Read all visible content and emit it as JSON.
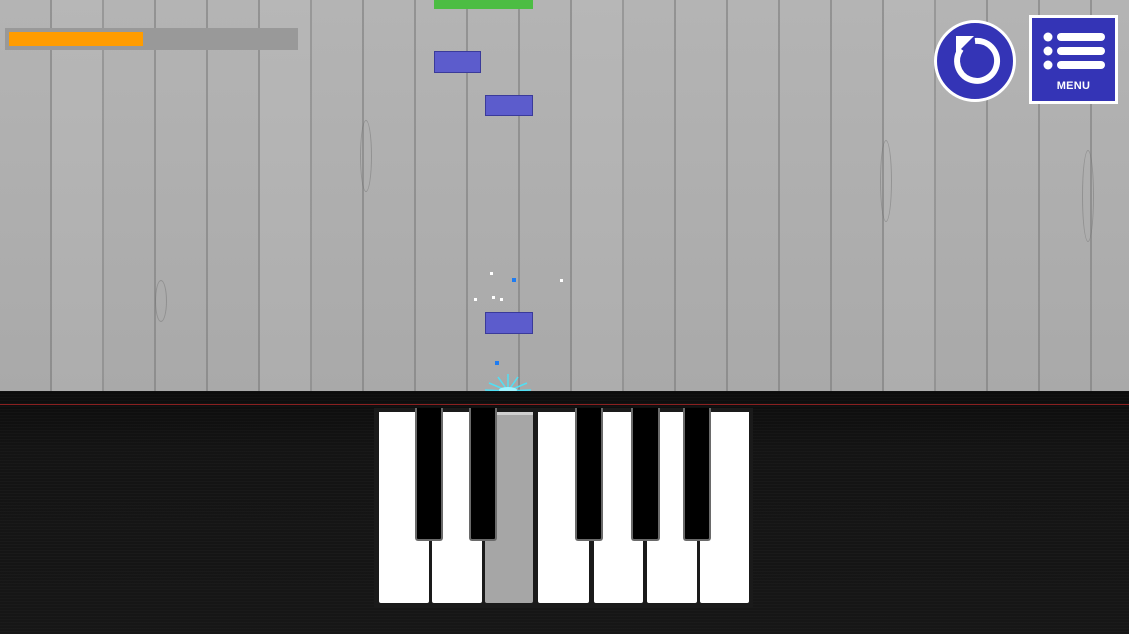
{
  "game": {
    "progress": 0.47,
    "colors": {
      "progress_fill": "#ff9c00",
      "note_blue": "#5c5ccc",
      "note_green": "#4cbd43",
      "button_blue": "#3434b6",
      "hit_line": "#8a2020"
    }
  },
  "hud": {
    "restart_icon": "restart-icon",
    "menu_icon": "list-icon",
    "menu_label": "MENU"
  },
  "keyboard": {
    "white_keys": 7,
    "black_keys": 5,
    "pressed_white_key": 3
  }
}
